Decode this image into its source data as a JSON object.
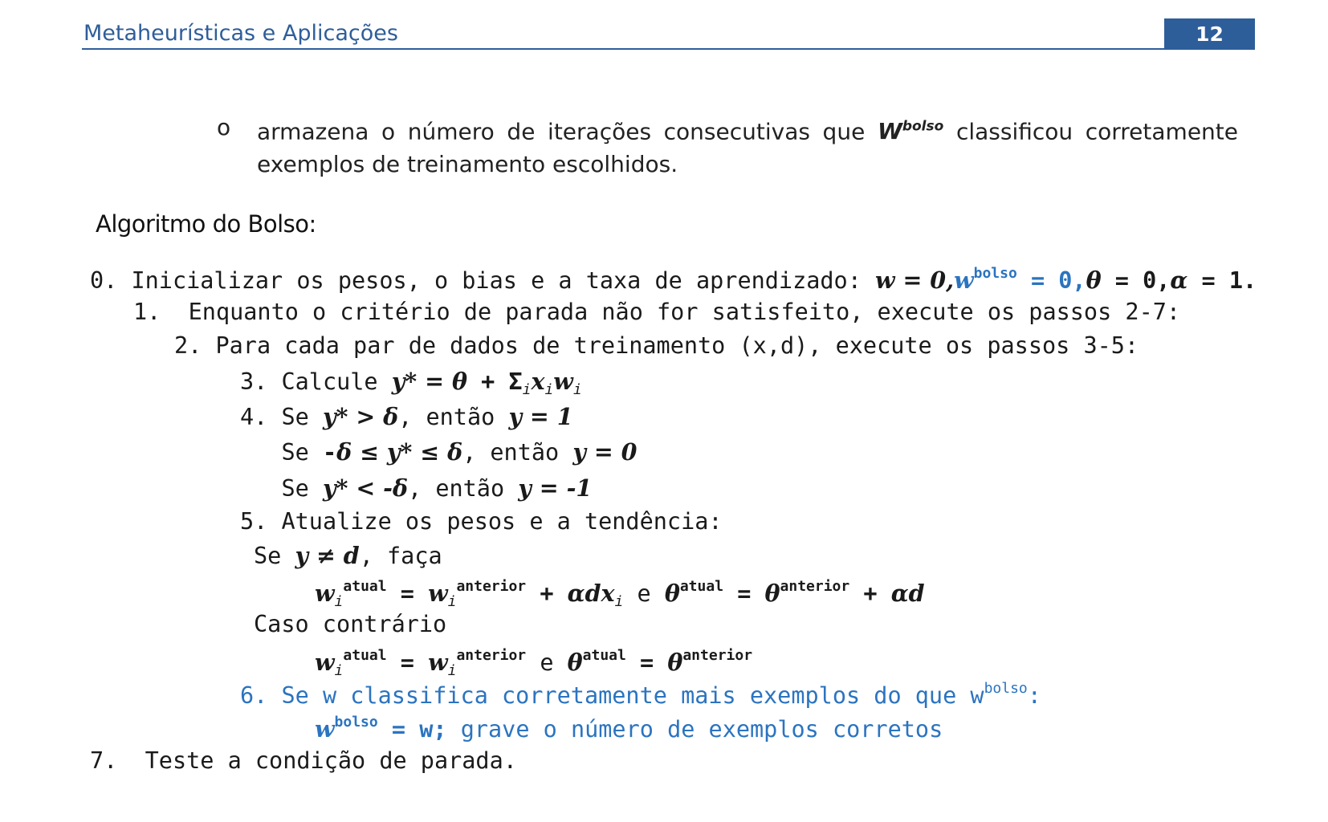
{
  "header": {
    "title": "Metaheurísticas e Aplicações",
    "page_number": "12"
  },
  "bullet": {
    "mark": "o",
    "text_before": "armazena o número de iterações consecutivas que",
    "w": "W",
    "w_sup": "bolso",
    "text_after": "classificou corretamente exemplos de treinamento escolhidos."
  },
  "section_title": "Algoritmo do Bolso:",
  "alg": {
    "l0_text": "0. Inicializar os pesos, o bias e a taxa de aprendizado: ",
    "l0_w": "w = 0,",
    "l0_w2": "w",
    "bolso": "bolso",
    "l0_eq0": " = 0,",
    "theta": "θ",
    "l0_rest": " = 0,",
    "alpha": "α",
    "l0_end": " = 1.",
    "l1": "1.  Enquanto o critério de parada não for satisfeito, execute os passos 2-7:",
    "l2": "2. Para cada par de dados de treinamento (x,d), execute os passos 3-5:",
    "l3_a": "3. Calcule ",
    "l3_ystar": "y* = ",
    "l3_plus": " + Σ",
    "l3_i": "i",
    "l3_x": "x",
    "l3_w": "w",
    "l4_a": "4. Se ",
    "l4_cond": "y* > ",
    "delta": "δ",
    "l4_then": ", então ",
    "l4_res": "y = 1",
    "l4b_a": "   Se ",
    "l4b_cond1": "-",
    "l4b_cond2": " ≤ y* ≤ ",
    "l4b_res": "y = 0",
    "l4c_cond": "y* < -",
    "l4c_res": "y = -1",
    "l5": "5. Atualize os pesos e a tendência:",
    "se": "Se ",
    "y_ne_d": "y ≠ d",
    "faca": ", faça",
    "atual": "atual",
    "anterior": "anterior",
    "e": " e ",
    "ad": "αd",
    "adx": "αdx",
    "caso": "Caso contrário",
    "l6": "6. Se w classifica corretamente mais exemplos do que w",
    "l6_end": ":",
    "l6b_a": " = w; ",
    "l6b_b": "grave o número de exemplos corretos",
    "l7": "7.  Teste a condição de parada."
  }
}
